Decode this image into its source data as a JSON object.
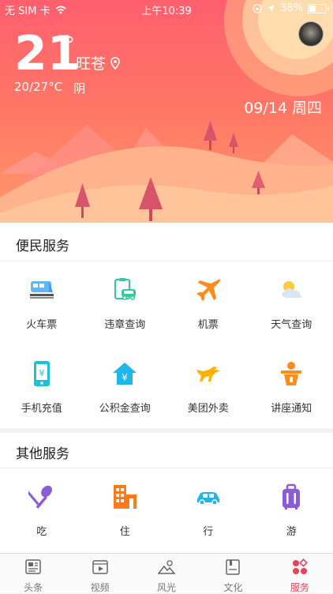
{
  "status": {
    "carrier": "无 SIM 卡",
    "time": "上午10:39",
    "battery": "38%"
  },
  "weather": {
    "temperature": "21",
    "degree": "°",
    "city": "旺苍",
    "range": "20/27°C",
    "condition": "阴",
    "date": "09/14 周四"
  },
  "services": {
    "title": "便民服务",
    "items": [
      {
        "label": "火车票",
        "icon": "train-icon"
      },
      {
        "label": "违章查询",
        "icon": "traffic-violation-icon"
      },
      {
        "label": "机票",
        "icon": "airplane-icon"
      },
      {
        "label": "天气查询",
        "icon": "weather-icon"
      },
      {
        "label": "手机充值",
        "icon": "phone-recharge-icon"
      },
      {
        "label": "公积金查询",
        "icon": "housing-fund-icon"
      },
      {
        "label": "美团外卖",
        "icon": "meituan-takeaway-icon"
      },
      {
        "label": "讲座通知",
        "icon": "lecture-notice-icon"
      }
    ]
  },
  "other": {
    "title": "其他服务",
    "items": [
      {
        "label": "吃",
        "icon": "food-icon"
      },
      {
        "label": "住",
        "icon": "hotel-icon"
      },
      {
        "label": "行",
        "icon": "car-icon"
      },
      {
        "label": "游",
        "icon": "luggage-icon"
      }
    ]
  },
  "tabs": [
    {
      "label": "头条",
      "icon": "news-icon"
    },
    {
      "label": "视频",
      "icon": "video-icon"
    },
    {
      "label": "风光",
      "icon": "scenery-icon"
    },
    {
      "label": "文化",
      "icon": "book-icon"
    },
    {
      "label": "服务",
      "icon": "services-icon",
      "active": true
    }
  ],
  "colors": {
    "accent": "#e8425a",
    "hero_top": "#ff5f6d",
    "hero_bottom": "#ff9a6a"
  }
}
